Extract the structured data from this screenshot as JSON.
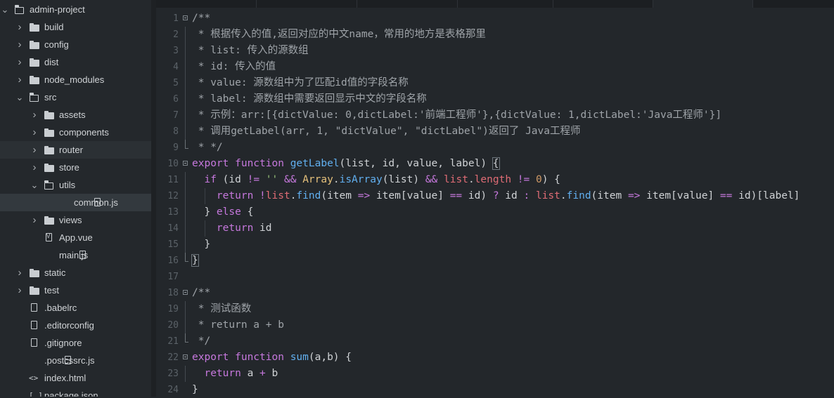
{
  "sidebar": {
    "items": [
      {
        "label": "admin-project",
        "depth": 0,
        "kind": "folder-open",
        "expanded": true
      },
      {
        "label": "build",
        "depth": 1,
        "kind": "folder",
        "expanded": false
      },
      {
        "label": "config",
        "depth": 1,
        "kind": "folder",
        "expanded": false
      },
      {
        "label": "dist",
        "depth": 1,
        "kind": "folder",
        "expanded": false
      },
      {
        "label": "node_modules",
        "depth": 1,
        "kind": "folder",
        "expanded": false
      },
      {
        "label": "src",
        "depth": 1,
        "kind": "folder-open",
        "expanded": true
      },
      {
        "label": "assets",
        "depth": 2,
        "kind": "folder",
        "expanded": false
      },
      {
        "label": "components",
        "depth": 2,
        "kind": "folder",
        "expanded": false
      },
      {
        "label": "router",
        "depth": 2,
        "kind": "folder",
        "expanded": false,
        "hover": true
      },
      {
        "label": "store",
        "depth": 2,
        "kind": "folder",
        "expanded": false
      },
      {
        "label": "utils",
        "depth": 2,
        "kind": "folder-open",
        "expanded": true
      },
      {
        "label": "common.js",
        "depth": 3,
        "kind": "file-code",
        "selected": true
      },
      {
        "label": "views",
        "depth": 2,
        "kind": "folder",
        "expanded": false
      },
      {
        "label": "App.vue",
        "depth": 2,
        "kind": "file-vue"
      },
      {
        "label": "main.js",
        "depth": 2,
        "kind": "file-code"
      },
      {
        "label": "static",
        "depth": 1,
        "kind": "folder",
        "expanded": false
      },
      {
        "label": "test",
        "depth": 1,
        "kind": "folder",
        "expanded": false
      },
      {
        "label": ".babelrc",
        "depth": 1,
        "kind": "file"
      },
      {
        "label": ".editorconfig",
        "depth": 1,
        "kind": "file"
      },
      {
        "label": ".gitignore",
        "depth": 1,
        "kind": "file"
      },
      {
        "label": ".postcssrc.js",
        "depth": 1,
        "kind": "file-code"
      },
      {
        "label": "index.html",
        "depth": 1,
        "kind": "file-html"
      },
      {
        "label": "package.json",
        "depth": 1,
        "kind": "file-json"
      }
    ]
  },
  "editor": {
    "file": "common.js",
    "lines": [
      {
        "n": "1",
        "tokens": [
          [
            "c",
            "/**"
          ]
        ]
      },
      {
        "n": "2",
        "tokens": [
          [
            "c",
            " * 根据传入的值,返回对应的中文name，常用的地方是表格那里"
          ]
        ]
      },
      {
        "n": "3",
        "tokens": [
          [
            "c",
            " * list: 传入的源数组"
          ]
        ]
      },
      {
        "n": "4",
        "tokens": [
          [
            "c",
            " * id: 传入的值"
          ]
        ]
      },
      {
        "n": "5",
        "tokens": [
          [
            "c",
            " * value: 源数组中为了匹配id值的字段名称"
          ]
        ]
      },
      {
        "n": "6",
        "tokens": [
          [
            "c",
            " * label: 源数组中需要返回显示中文的字段名称"
          ]
        ]
      },
      {
        "n": "7",
        "tokens": [
          [
            "c",
            " * 示例：arr:[{dictValue: 0,dictLabel:'前端工程师'},{dictValue: 1,dictLabel:'Java工程师'}]"
          ]
        ]
      },
      {
        "n": "8",
        "tokens": [
          [
            "c",
            " * 调用getLabel(arr, 1, \"dictValue\", \"dictLabel\")返回了 Java工程师"
          ]
        ]
      },
      {
        "n": "9",
        "tokens": [
          [
            "c",
            " * */"
          ]
        ]
      },
      {
        "n": "10",
        "tokens": [
          [
            "k",
            "export "
          ],
          [
            "k",
            "function "
          ],
          [
            "f",
            "getLabel"
          ],
          [
            "p",
            "(list, id, value, label) "
          ],
          [
            "b",
            "{"
          ]
        ]
      },
      {
        "n": "11",
        "tokens": [
          [
            "p",
            "  "
          ],
          [
            "k",
            "if "
          ],
          [
            "p",
            "(id "
          ],
          [
            "o",
            "!= "
          ],
          [
            "s",
            "'' "
          ],
          [
            "o",
            "&& "
          ],
          [
            "y",
            "Array"
          ],
          [
            "p",
            "."
          ],
          [
            "f",
            "isArray"
          ],
          [
            "p",
            "(list) "
          ],
          [
            "o",
            "&& "
          ],
          [
            "v",
            "list"
          ],
          [
            "p",
            "."
          ],
          [
            "v",
            "length "
          ],
          [
            "o",
            "!= "
          ],
          [
            "n",
            "0"
          ],
          [
            "p",
            ") {"
          ]
        ]
      },
      {
        "n": "12",
        "tokens": [
          [
            "p",
            "    "
          ],
          [
            "k",
            "return "
          ],
          [
            "o",
            "!"
          ],
          [
            "v",
            "list"
          ],
          [
            "p",
            "."
          ],
          [
            "f",
            "find"
          ],
          [
            "p",
            "(item "
          ],
          [
            "o",
            "=> "
          ],
          [
            "p",
            "item[value] "
          ],
          [
            "o",
            "== "
          ],
          [
            "p",
            "id) "
          ],
          [
            "o",
            "? "
          ],
          [
            "p",
            "id "
          ],
          [
            "o",
            ": "
          ],
          [
            "v",
            "list"
          ],
          [
            "p",
            "."
          ],
          [
            "f",
            "find"
          ],
          [
            "p",
            "(item "
          ],
          [
            "o",
            "=> "
          ],
          [
            "p",
            "item[value] "
          ],
          [
            "o",
            "== "
          ],
          [
            "p",
            "id)[label]"
          ]
        ]
      },
      {
        "n": "13",
        "tokens": [
          [
            "p",
            "  } "
          ],
          [
            "k",
            "else "
          ],
          [
            "p",
            "{"
          ]
        ]
      },
      {
        "n": "14",
        "tokens": [
          [
            "p",
            "    "
          ],
          [
            "k",
            "return "
          ],
          [
            "p",
            "id"
          ]
        ]
      },
      {
        "n": "15",
        "tokens": [
          [
            "p",
            "  }"
          ]
        ]
      },
      {
        "n": "16",
        "tokens": [
          [
            "b",
            "}"
          ]
        ]
      },
      {
        "n": "17",
        "tokens": []
      },
      {
        "n": "18",
        "tokens": [
          [
            "c",
            "/**"
          ]
        ]
      },
      {
        "n": "19",
        "tokens": [
          [
            "c",
            " * 测试函数"
          ]
        ]
      },
      {
        "n": "20",
        "tokens": [
          [
            "c",
            " * return a + b"
          ]
        ]
      },
      {
        "n": "21",
        "tokens": [
          [
            "c",
            " */"
          ]
        ]
      },
      {
        "n": "22",
        "tokens": [
          [
            "k",
            "export "
          ],
          [
            "k",
            "function "
          ],
          [
            "f",
            "sum"
          ],
          [
            "p",
            "(a,b) {"
          ]
        ]
      },
      {
        "n": "23",
        "tokens": [
          [
            "p",
            "  "
          ],
          [
            "k",
            "return "
          ],
          [
            "p",
            "a "
          ],
          [
            "o",
            "+ "
          ],
          [
            "p",
            "b"
          ]
        ]
      },
      {
        "n": "24",
        "tokens": [
          [
            "p",
            "}"
          ]
        ]
      }
    ]
  }
}
